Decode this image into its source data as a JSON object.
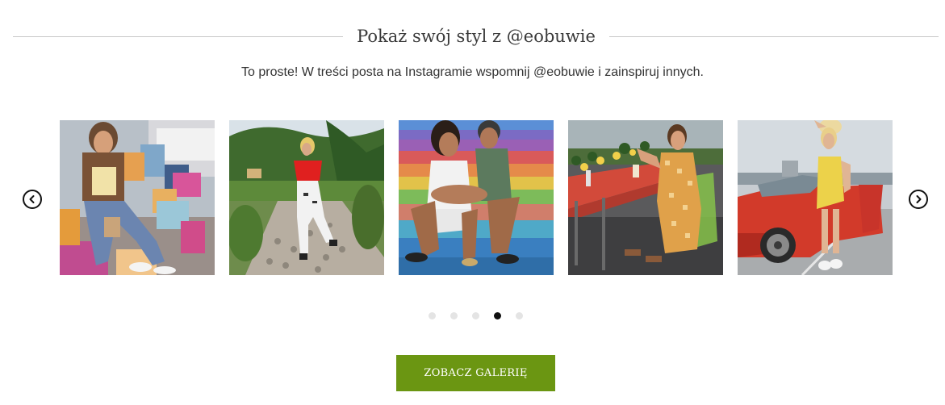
{
  "section": {
    "title": "Pokaż swój styl z @eobuwie",
    "subtitle": "To proste! W treści posta na Instagramie wspomnij @eobuwie i zainspiruj innych."
  },
  "carousel": {
    "prev_icon": "chevron-left-icon",
    "next_icon": "chevron-right-icon",
    "photos": [
      {
        "subject": "woman-colorful-blocks"
      },
      {
        "subject": "woman-red-top-garden-path"
      },
      {
        "subject": "couple-rainbow-stairs"
      },
      {
        "subject": "woman-dining-table"
      },
      {
        "subject": "woman-red-car"
      }
    ],
    "pagination": {
      "count": 5,
      "active_index": 3
    }
  },
  "cta": {
    "label": "ZOBACZ GALERIĘ"
  },
  "colors": {
    "accent": "#6b9612",
    "text": "#333333",
    "active_dot": "#111111",
    "inactive_dot": "#e4e4e4"
  }
}
